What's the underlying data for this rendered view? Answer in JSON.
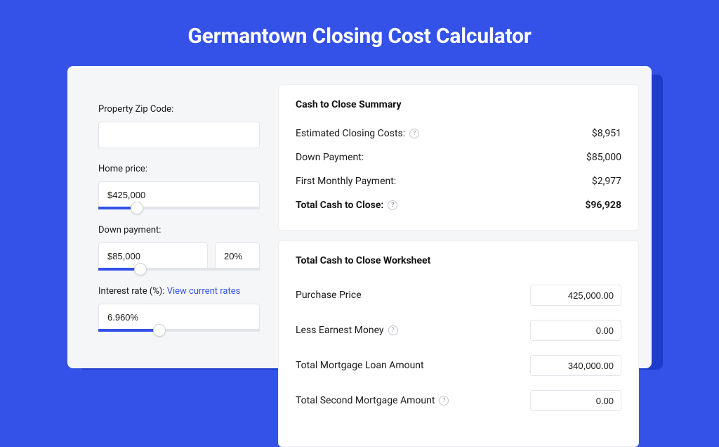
{
  "title": "Germantown Closing Cost Calculator",
  "inputs": {
    "zip_label": "Property Zip Code:",
    "zip_value": "",
    "home_price_label": "Home price:",
    "home_price_value": "$425,000",
    "home_price_slider_pct": 24,
    "down_payment_label": "Down payment:",
    "down_payment_value": "$85,000",
    "down_payment_pct": "20%",
    "down_payment_slider_pct": 26,
    "interest_label_prefix": "Interest rate (%): ",
    "interest_link": "View current rates",
    "interest_value": "6.960%",
    "interest_slider_pct": 38
  },
  "summary": {
    "title": "Cash to Close Summary",
    "rows": [
      {
        "label": "Estimated Closing Costs:",
        "help": true,
        "value": "$8,951",
        "bold": false
      },
      {
        "label": "Down Payment:",
        "help": false,
        "value": "$85,000",
        "bold": false
      },
      {
        "label": "First Monthly Payment:",
        "help": false,
        "value": "$2,977",
        "bold": false
      },
      {
        "label": "Total Cash to Close:",
        "help": true,
        "value": "$96,928",
        "bold": true
      }
    ]
  },
  "worksheet": {
    "title": "Total Cash to Close Worksheet",
    "rows": [
      {
        "label": "Purchase Price",
        "help": false,
        "value": "425,000.00"
      },
      {
        "label": "Less Earnest Money",
        "help": true,
        "value": "0.00"
      },
      {
        "label": "Total Mortgage Loan Amount",
        "help": false,
        "value": "340,000.00"
      },
      {
        "label": "Total Second Mortgage Amount",
        "help": true,
        "value": "0.00"
      }
    ]
  }
}
